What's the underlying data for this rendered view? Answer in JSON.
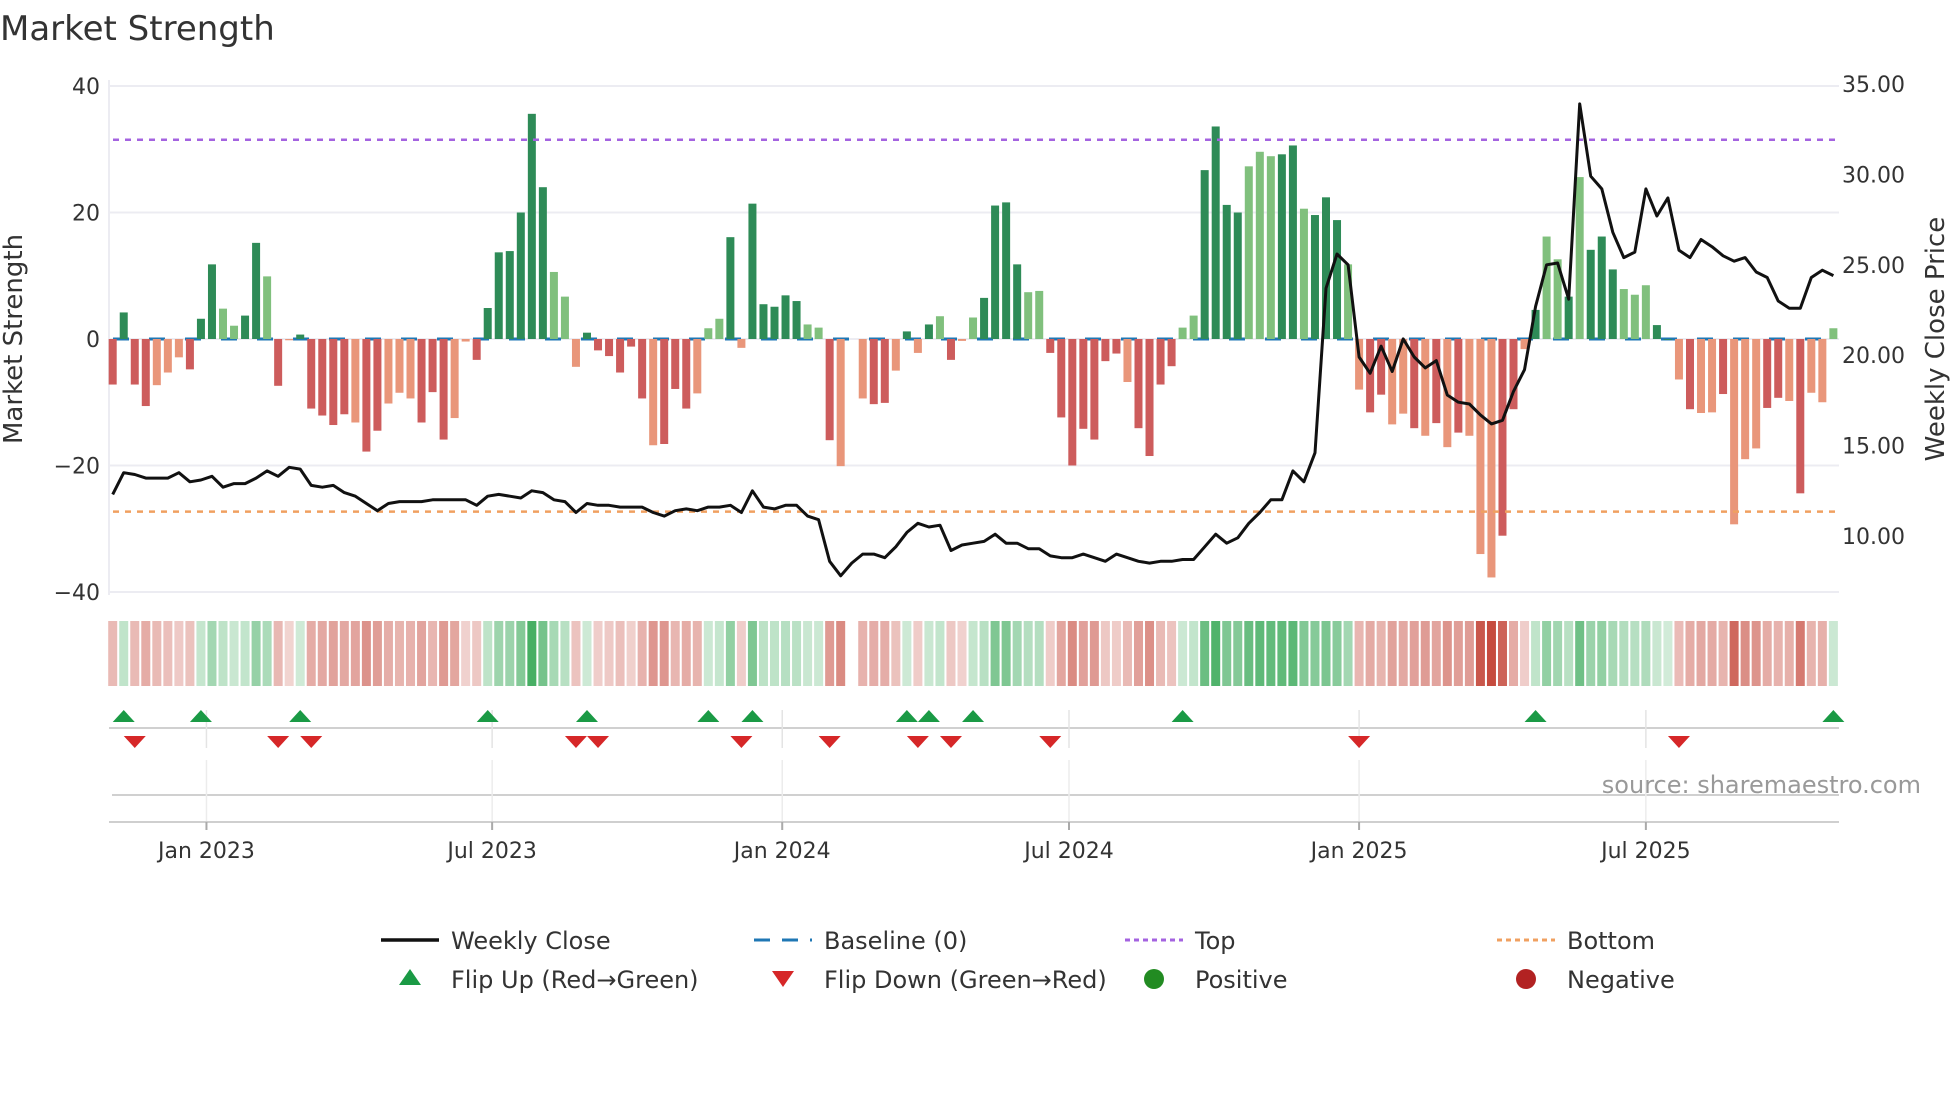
{
  "chart_data": {
    "type": "bar",
    "title": "Market Strength",
    "ylabel": "Market Strength",
    "y2label": "Weekly Close Price",
    "ylim": [
      -40,
      40
    ],
    "y2lim": [
      7,
      35
    ],
    "yticks": [
      "40",
      "20",
      "0",
      "−20",
      "−40"
    ],
    "ytick_values": [
      40,
      20,
      0,
      -20,
      -40
    ],
    "y2ticks": [
      "35.00",
      "30.00",
      "25.00",
      "20.00",
      "15.00",
      "10.00"
    ],
    "y2tick_values": [
      35,
      30,
      25,
      20,
      15,
      10
    ],
    "xticks": [
      "Jan 2023",
      "Jul 2023",
      "Jan 2024",
      "Jul 2024",
      "Jan 2025",
      "Jul 2025"
    ],
    "xtick_weeks": [
      9.5,
      35.4,
      61.7,
      87.7,
      114.0,
      140.0
    ],
    "top_level": 31.5,
    "bottom_level": -27.3,
    "grid": true,
    "source": "source: sharemaestro.com",
    "colors": {
      "pos_strong": "#2e8b57",
      "pos_weak": "#80c07d",
      "neg_strong": "#cd5c5c",
      "neg_weak": "#e9967a",
      "price": "#111111",
      "baseline": "#1f77b4",
      "top": "#a463e0",
      "bottom": "#f0a060",
      "flip_up": "#1a9a45",
      "flip_down": "#d62728",
      "positive": "#228b22",
      "negative": "#b22222"
    },
    "strength": [
      -7.2,
      4.2,
      -7.2,
      -10.6,
      -7.3,
      -5.3,
      -2.9,
      -4.8,
      3.2,
      11.8,
      4.8,
      2.1,
      3.7,
      15.2,
      9.9,
      -7.4,
      -0.2,
      0.7,
      -11,
      -12.1,
      -13.6,
      -11.9,
      -13.2,
      -17.8,
      -14.5,
      -10.2,
      -8.5,
      -9.4,
      -13.2,
      -8.4,
      -15.9,
      -12.5,
      -0.4,
      -3.3,
      4.9,
      13.7,
      13.9,
      20,
      35.6,
      24,
      10.6,
      6.7,
      -4.4,
      1,
      -1.8,
      -2.7,
      -5.3,
      -1.2,
      -9.4,
      -16.8,
      -16.6,
      -7.9,
      -11,
      -8.6,
      1.7,
      3.2,
      16.1,
      -1.4,
      21.4,
      5.5,
      5.1,
      6.9,
      6,
      2.3,
      1.8,
      -16,
      -20.1,
      null,
      -9.4,
      -10.3,
      -10.1,
      -5,
      1.2,
      -2.2,
      2.3,
      3.6,
      -3.3,
      -0.3,
      3.4,
      6.5,
      21.1,
      21.6,
      11.8,
      7.4,
      7.6,
      -2.2,
      -12.4,
      -20,
      -14.2,
      -15.9,
      -3.5,
      -2.3,
      -6.8,
      -14.1,
      -18.5,
      -7.2,
      -4.3,
      1.8,
      3.7,
      26.7,
      33.6,
      21.2,
      20,
      27.3,
      29.6,
      28.9,
      29.2,
      30.6,
      20.6,
      19.6,
      22.4,
      18.8,
      11.8,
      -8,
      -11.6,
      -8.8,
      -13.5,
      -11.8,
      -14.1,
      -15.3,
      -13.3,
      -17.1,
      -14.8,
      -15.3,
      -34,
      -37.7,
      -31.1,
      -11.1,
      -1.6,
      4.6,
      16.2,
      12.6,
      6.7,
      25.6,
      14.1,
      16.2,
      11,
      7.9,
      7,
      8.5,
      2.2,
      0,
      -6.4,
      -11.1,
      -11.7,
      -11.6,
      -8.7,
      -29.3,
      -19,
      -17.3,
      -10.9,
      -9.3,
      -9.8,
      -24.4,
      -8.5,
      -10,
      1.7
    ],
    "shade": "ddddllldddllddldldddddlddllldddlldddddddlllddddddldddllldldddddlldlllddldldldllddddlldddddddlddddllddddlllddldddllddlldldldlllddldlldldddlllddldlldlllddldlllddldddllllddlldd",
    "weekly_close": [
      12.3,
      13.5,
      13.4,
      13.2,
      13.2,
      13.2,
      13.5,
      13.0,
      13.1,
      13.3,
      12.7,
      12.9,
      12.9,
      13.2,
      13.6,
      13.3,
      13.8,
      13.7,
      12.8,
      12.7,
      12.8,
      12.4,
      12.2,
      11.8,
      11.4,
      11.8,
      11.9,
      11.9,
      11.9,
      12.0,
      12.0,
      12.0,
      12.0,
      11.7,
      12.2,
      12.3,
      12.2,
      12.1,
      12.5,
      12.4,
      12.0,
      11.9,
      11.3,
      11.8,
      11.7,
      11.7,
      11.6,
      11.6,
      11.6,
      11.3,
      11.1,
      11.4,
      11.5,
      11.4,
      11.6,
      11.6,
      11.7,
      11.3,
      12.5,
      11.6,
      11.5,
      11.7,
      11.7,
      11.1,
      10.9,
      8.6,
      7.8,
      8.5,
      9.0,
      9.0,
      8.8,
      9.4,
      10.2,
      10.7,
      10.5,
      10.6,
      9.2,
      9.5,
      9.6,
      9.7,
      10.1,
      9.6,
      9.6,
      9.3,
      9.3,
      8.9,
      8.8,
      8.8,
      9.0,
      8.8,
      8.6,
      9.0,
      8.8,
      8.6,
      8.5,
      8.6,
      8.6,
      8.7,
      8.7,
      9.4,
      10.1,
      9.6,
      9.9,
      10.7,
      11.3,
      12.0,
      12.0,
      13.6,
      13.0,
      14.6,
      23.7,
      25.6,
      25.0,
      19.9,
      19.0,
      20.5,
      19.1,
      20.9,
      19.9,
      19.3,
      19.7,
      17.8,
      17.4,
      17.3,
      16.7,
      16.2,
      16.4,
      18.0,
      19.2,
      22.7,
      25.0,
      25.1,
      23.1,
      33.9,
      29.9,
      29.2,
      26.8,
      25.4,
      25.7,
      29.2,
      27.7,
      28.7,
      25.8,
      25.4,
      26.4,
      26.0,
      25.5,
      25.2,
      25.4,
      24.6,
      24.3,
      23.0,
      22.6,
      22.6,
      24.3,
      24.7,
      24.4
    ],
    "flip_up_weeks": [
      2,
      9,
      18,
      35,
      44,
      55,
      59,
      73,
      75,
      79,
      98,
      130,
      157
    ],
    "flip_down_weeks": [
      3,
      16,
      19,
      43,
      45,
      58,
      66,
      74,
      77,
      86,
      114,
      143
    ],
    "legend": [
      {
        "label": "Weekly Close",
        "kind": "line"
      },
      {
        "label": "Baseline (0)",
        "kind": "dash"
      },
      {
        "label": "Top",
        "kind": "dot-top"
      },
      {
        "label": "Bottom",
        "kind": "dot-bottom"
      },
      {
        "label": "Flip Up (Red→Green)",
        "kind": "tri-up"
      },
      {
        "label": "Flip Down (Green→Red)",
        "kind": "tri-down"
      },
      {
        "label": "Positive",
        "kind": "dot-pos"
      },
      {
        "label": "Negative",
        "kind": "dot-neg"
      }
    ],
    "legend_placement": "bottom-center"
  }
}
